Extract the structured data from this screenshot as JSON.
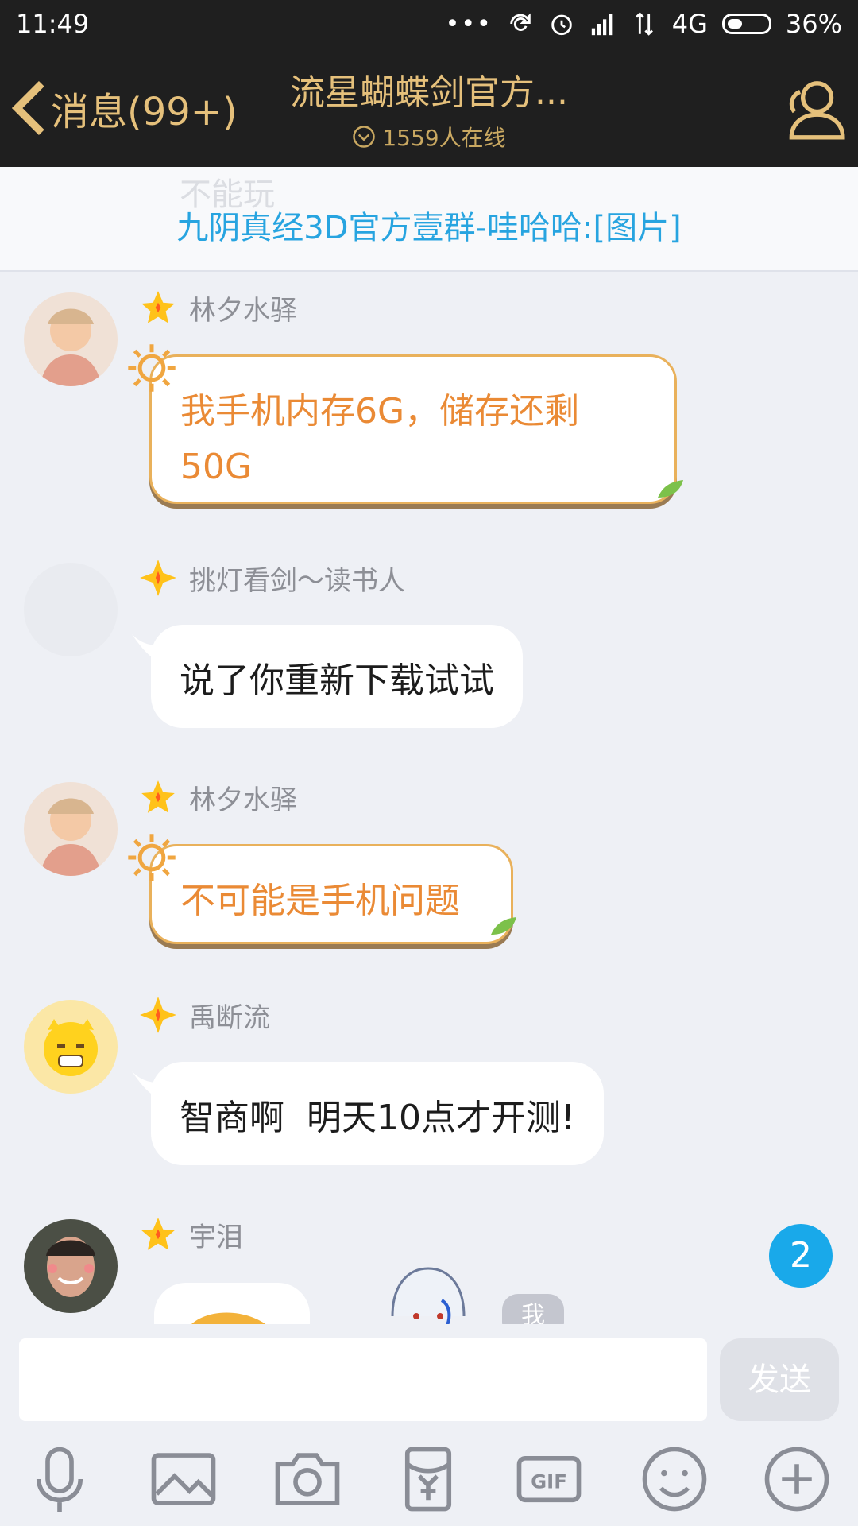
{
  "status_bar": {
    "time": "11:49",
    "dots": "•••",
    "network": "4G",
    "battery": "36%"
  },
  "header": {
    "back_label": "消息(99+)",
    "title": "流星蝴蝶剑官方...",
    "online": "1559人在线"
  },
  "notice": {
    "ghost_text": "不能玩",
    "text": "九阴真经3D官方壹群-哇哈哈:[图片]"
  },
  "messages": [
    {
      "sender": "林夕水驿",
      "text_line1": "我手机内存6G，储存还剩",
      "text_line2": "50G",
      "style": "gold"
    },
    {
      "sender": "挑灯看剑～读书人",
      "text": "说了你重新下载试试",
      "style": "white"
    },
    {
      "sender": "林夕水驿",
      "text": "不可能是手机问题",
      "style": "gold"
    },
    {
      "sender": "禹断流",
      "text": "智商啊  明天10点才开测!",
      "style": "white"
    },
    {
      "sender": "宇泪",
      "style": "partial"
    }
  ],
  "unread_count": "2",
  "me_tag": "我",
  "composer": {
    "send_label": "发送"
  },
  "toolbar_icons": [
    "mic-icon",
    "image-icon",
    "camera-icon",
    "red-packet-icon",
    "gif-icon",
    "emoji-icon",
    "plus-icon"
  ],
  "colors": {
    "accent_gold": "#e5c07b",
    "link_blue": "#27a4e0",
    "bubble_orange_text": "#ea8a35",
    "badge_blue": "#19a9ea"
  }
}
